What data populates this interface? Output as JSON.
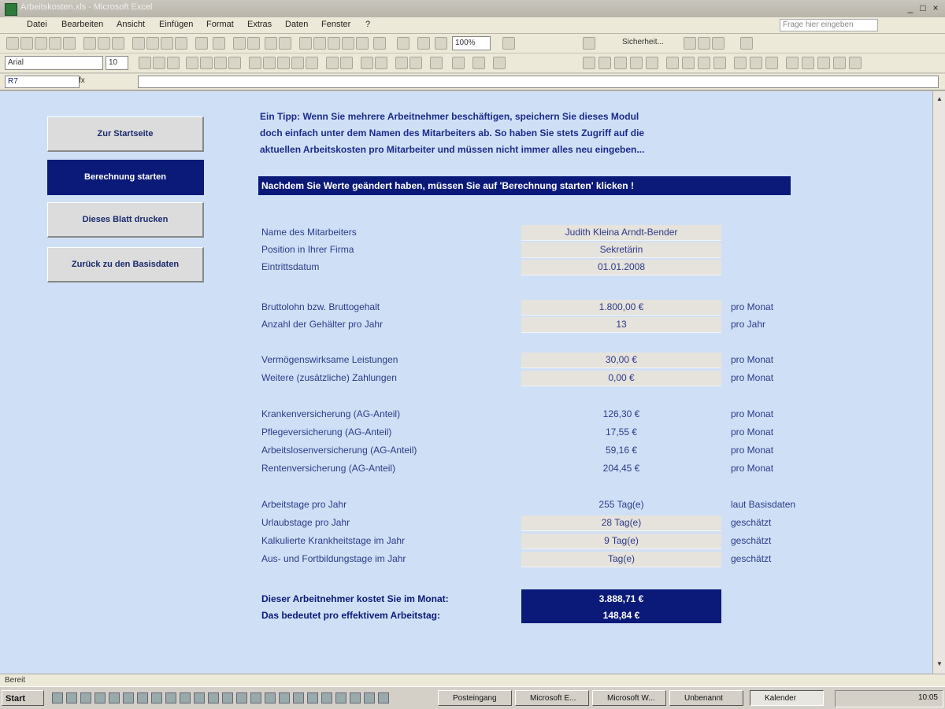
{
  "window": {
    "title": "Arbeitskosten.xls - Microsoft Excel"
  },
  "menu": {
    "items": [
      "Datei",
      "Bearbeiten",
      "Ansicht",
      "Einfügen",
      "Format",
      "Extras",
      "Daten",
      "Fenster",
      "?"
    ],
    "help_placeholder": "Frage hier eingeben"
  },
  "toolbar": {
    "zoom": "100%",
    "font": "Arial",
    "font_size": "10",
    "security_label": "Sicherheit..."
  },
  "formula_bar": {
    "name_box": "R7",
    "fx": "fx"
  },
  "nav": {
    "start": "Zur Startseite",
    "calc": "Berechnung starten",
    "print": "Dieses Blatt drucken",
    "back": "Zurück zu den Basisdaten"
  },
  "tip_lines": [
    "Ein Tipp: Wenn Sie mehrere Arbeitnehmer beschäftigen, speichern Sie dieses Modul",
    "doch einfach unter dem Namen des Mitarbeiters ab. So haben Sie stets Zugriff auf die",
    "aktuellen Arbeitskosten pro Mitarbeiter und müssen nicht immer alles neu eingeben..."
  ],
  "hint": "Nachdem Sie Werte geändert haben, müssen Sie auf 'Berechnung starten' klicken !",
  "employee": {
    "name_label": "Name des Mitarbeiters",
    "name_value": "Judith Kleina Arndt-Bender",
    "position_label": "Position in Ihrer Firma",
    "position_value": "Sekretärin",
    "entry_label": "Eintrittsdatum",
    "entry_value": "01.01.2008"
  },
  "salary": {
    "gross_label": "Bruttolohn bzw. Bruttogehalt",
    "gross_value": "1.800,00 €",
    "gross_unit": "pro Monat",
    "count_label": "Anzahl der Gehälter pro Jahr",
    "count_value": "13",
    "count_unit": "pro Jahr"
  },
  "benefits": {
    "vwl_label": "Vermögenswirksame Leistungen",
    "vwl_value": "30,00 €",
    "vwl_unit": "pro Monat",
    "extra_label": "Weitere (zusätzliche) Zahlungen",
    "extra_value": "0,00 €",
    "extra_unit": "pro Monat"
  },
  "insurance": {
    "health_label": "Krankenversicherung (AG-Anteil)",
    "health_value": "126,30 €",
    "health_unit": "pro Monat",
    "care_label": "Pflegeversicherung (AG-Anteil)",
    "care_value": "17,55 €",
    "care_unit": "pro Monat",
    "unemployment_label": "Arbeitslosenversicherung (AG-Anteil)",
    "unemployment_value": "59,16 €",
    "unemployment_unit": "pro Monat",
    "pension_label": "Rentenversicherung (AG-Anteil)",
    "pension_value": "204,45 €",
    "pension_unit": "pro Monat"
  },
  "days": {
    "work_label": "Arbeitstage pro Jahr",
    "work_value": "255 Tag(e)",
    "work_unit": "laut Basisdaten",
    "vacation_label": "Urlaubstage pro Jahr",
    "vacation_value": "28 Tag(e)",
    "vacation_unit": "geschätzt",
    "sick_label": "Kalkulierte Krankheitstage im Jahr",
    "sick_value": "9 Tag(e)",
    "sick_unit": "geschätzt",
    "training_label": "Aus- und Fortbildungstage im Jahr",
    "training_value": "Tag(e)",
    "training_unit": "geschätzt"
  },
  "totals": {
    "month_label": "Dieser Arbeitnehmer kostet Sie im Monat:",
    "month_value": "3.888,71 €",
    "day_label": "Das bedeutet pro effektivem Arbeitstag:",
    "day_value": "148,84 €"
  },
  "status": "Bereit",
  "taskbar": {
    "start": "Start",
    "tasks": [
      "Posteingang",
      "Microsoft E...",
      "Microsoft W...",
      "Unbenannt",
      "Kalender"
    ],
    "clock": "10:05"
  }
}
